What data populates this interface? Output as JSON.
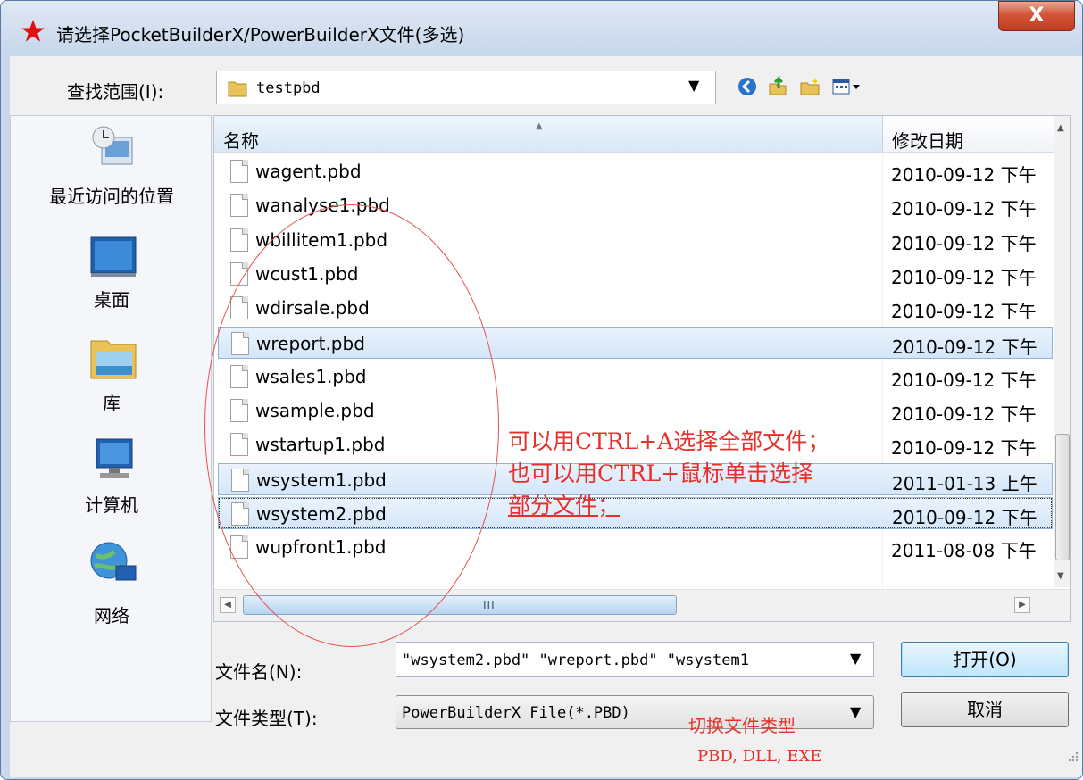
{
  "dialog": {
    "title": "请选择PocketBuilderX/PowerBuilderX文件(多选)",
    "close_label": "X"
  },
  "lookin": {
    "label": "查找范围(I):",
    "value": "testpbd"
  },
  "places": [
    {
      "label": "最近访问的位置",
      "icon": "recent-places-icon"
    },
    {
      "label": "桌面",
      "icon": "desktop-icon"
    },
    {
      "label": "库",
      "icon": "libraries-icon"
    },
    {
      "label": "计算机",
      "icon": "computer-icon"
    },
    {
      "label": "网络",
      "icon": "network-icon"
    }
  ],
  "filelist": {
    "columns": {
      "name": "名称",
      "date": "修改日期"
    },
    "files": [
      {
        "name": "wagent.pbd",
        "date": "2010-09-12 下午",
        "selected": false
      },
      {
        "name": "wanalyse1.pbd",
        "date": "2010-09-12 下午",
        "selected": false
      },
      {
        "name": "wbillitem1.pbd",
        "date": "2010-09-12 下午",
        "selected": false
      },
      {
        "name": "wcust1.pbd",
        "date": "2010-09-12 下午",
        "selected": false
      },
      {
        "name": "wdirsale.pbd",
        "date": "2010-09-12 下午",
        "selected": false
      },
      {
        "name": "wreport.pbd",
        "date": "2010-09-12 下午",
        "selected": true
      },
      {
        "name": "wsales1.pbd",
        "date": "2010-09-12 下午",
        "selected": false
      },
      {
        "name": "wsample.pbd",
        "date": "2010-09-12 下午",
        "selected": false
      },
      {
        "name": "wstartup1.pbd",
        "date": "2010-09-12 下午",
        "selected": false
      },
      {
        "name": "wsystem1.pbd",
        "date": "2011-01-13 上午",
        "selected": true
      },
      {
        "name": "wsystem2.pbd",
        "date": "2010-09-12 下午",
        "selected": true
      },
      {
        "name": "wupfront1.pbd",
        "date": "2011-08-08 下午",
        "selected": false
      }
    ]
  },
  "annotations": {
    "select_tip_line1": "可以用CTRL+A选择全部文件；",
    "select_tip_line2": "也可以用CTRL+鼠标单击选择",
    "select_tip_line3": "部分文件；",
    "filetype_tip_line1": "切换文件类型",
    "filetype_tip_line2": "PBD, DLL, EXE",
    "color": "#e8302a"
  },
  "filename": {
    "label": "文件名(N):",
    "value": "\"wsystem2.pbd\" \"wreport.pbd\" \"wsystem1"
  },
  "filetype": {
    "label": "文件类型(T):",
    "value": "PowerBuilderX File(*.PBD)"
  },
  "buttons": {
    "open": "打开(O)",
    "cancel": "取消"
  }
}
